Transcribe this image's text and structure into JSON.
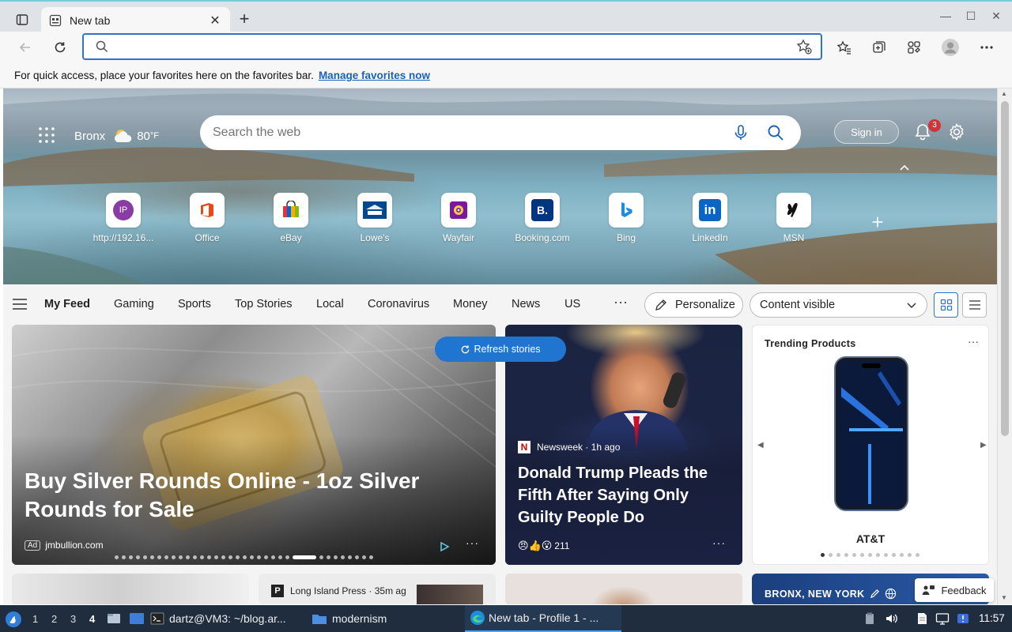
{
  "browser": {
    "tab_title": "New tab",
    "address_value": "",
    "favbar_text": "For quick access, place your favorites here on the favorites bar.",
    "favbar_link": "Manage favorites now"
  },
  "hero": {
    "location": "Bronx",
    "temperature": "80",
    "temp_unit": "°F",
    "search_placeholder": "Search the web",
    "signin_label": "Sign in",
    "notification_count": "3",
    "tiles": [
      {
        "label": "http://192.16...",
        "icon": "ip-icon"
      },
      {
        "label": "Office",
        "icon": "office-icon"
      },
      {
        "label": "eBay",
        "icon": "ebay-icon"
      },
      {
        "label": "Lowe's",
        "icon": "lowes-icon"
      },
      {
        "label": "Wayfair",
        "icon": "wayfair-icon"
      },
      {
        "label": "Booking.com",
        "icon": "booking-icon"
      },
      {
        "label": "Bing",
        "icon": "bing-icon"
      },
      {
        "label": "LinkedIn",
        "icon": "linkedin-icon"
      },
      {
        "label": "MSN",
        "icon": "msn-icon"
      }
    ],
    "ip_badge": "IP",
    "booking_badge": "B.",
    "linkedin_badge": "in"
  },
  "feed_nav": {
    "items": [
      "My Feed",
      "Gaming",
      "Sports",
      "Top Stories",
      "Local",
      "Coronavirus",
      "Money",
      "News",
      "US"
    ],
    "more": "···",
    "personalize": "Personalize",
    "content_visible": "Content visible"
  },
  "cards": {
    "refresh_label": "Refresh stories",
    "ad": {
      "headline": "Buy Silver Rounds Online - 1oz Silver Rounds for Sale",
      "ad_badge": "Ad",
      "source": "jmbullion.com",
      "more": "···"
    },
    "news": {
      "source_logo": "N",
      "source": "Newsweek · 1h ago",
      "headline": "Donald Trump Pleads the Fifth After Saying Only Guilty People Do",
      "reaction_emojis": "😠👍😮",
      "reaction_count": "211",
      "more": "···"
    },
    "trending": {
      "title": "Trending Products",
      "brand": "AT&T",
      "more": "···"
    },
    "row2_source_logo": "P",
    "row2_source": "Long Island Press · 35m ag",
    "row2_location": "BRONX, NEW YORK",
    "feedback": "Feedback"
  },
  "taskbar": {
    "workspaces": [
      "1",
      "2",
      "3",
      "4"
    ],
    "terminal_task": "dartz@VM3: ~/blog.ar...",
    "folder_task": "modernism",
    "browser_task": "New tab - Profile 1 - ...",
    "clock": "11:57"
  },
  "colors": {
    "accent": "#2f74c6",
    "refresh": "#1f75d0",
    "taskbar": "#1f2d3f",
    "badge": "#d13438"
  }
}
